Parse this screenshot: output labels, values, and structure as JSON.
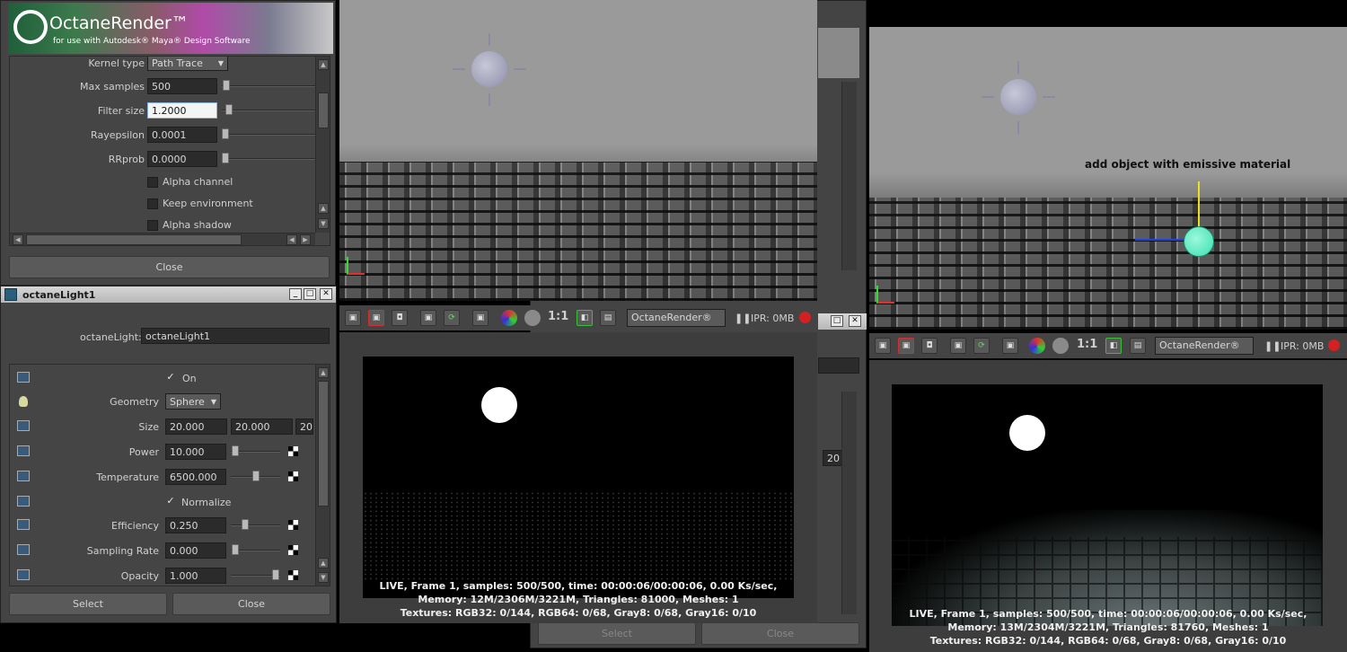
{
  "header": {
    "logo_title": "OctaneRender™",
    "logo_subtitle": "for use with Autodesk® Maya® Design Software"
  },
  "settings": {
    "kernel_label": "Kernel type",
    "kernel_value": "Path Trace",
    "max_samples_label": "Max samples",
    "max_samples_value": "500",
    "filter_size_label": "Filter size",
    "filter_size_value": "1.2000",
    "rayepsilon_label": "Rayepsilon",
    "rayepsilon_value": "0.0001",
    "rrprob_label": "RRprob",
    "rrprob_value": "0.0000",
    "alpha_channel_label": "Alpha channel",
    "keep_env_label": "Keep environment",
    "alpha_shadow_label": "Alpha shadow",
    "close_label": "Close"
  },
  "light_window": {
    "title": "octaneLight1",
    "name_label": "octaneLight:",
    "name_value": "octaneLight1",
    "on_label": "On",
    "on_checked": "✓",
    "geometry_label": "Geometry",
    "geometry_value": "Sphere",
    "size_label": "Size",
    "size_x": "20.000",
    "size_y": "20.000",
    "size_z": "20",
    "power_label": "Power",
    "power_value": "10.000",
    "temperature_label": "Temperature",
    "temperature_value": "6500.000",
    "normalize_label": "Normalize",
    "normalize_checked": "✓",
    "efficiency_label": "Efficiency",
    "efficiency_value": "0.250",
    "sampling_label": "Sampling Rate",
    "sampling_value": "0.000",
    "opacity_label": "Opacity",
    "opacity_value": "1.000",
    "select_label": "Select",
    "close_label": "Close"
  },
  "render_toolbar": {
    "ratio": "1:1",
    "renderer": "OctaneRender®",
    "ipr": "IPR: 0MB"
  },
  "render_left": {
    "line1": "LIVE, Frame 1, samples: 500/500, time: 00:00:06/00:00:06, 0.00 Ks/sec,",
    "line2": "Memory: 12M/2306M/3221M, Triangles: 81000, Meshes: 1",
    "line3": "Textures: RGB32: 0/144, RGB64: 0/68, Gray8: 0/68, Gray16: 0/10"
  },
  "render_right": {
    "line1": "LIVE, Frame 1, samples: 500/500, time: 00:00:06/00:00:06, 0.00 Ks/sec,",
    "line2": "Memory: 13M/2304M/3221M, Triangles: 81760, Meshes: 1",
    "line3": "Textures: RGB32: 0/144, RGB64: 0/68, Gray8: 0/68, Gray16: 0/10"
  },
  "annotation": "add object with emissive material",
  "background_window": {
    "select_label": "Select",
    "close_label": "Close",
    "size_z": "20"
  },
  "colors": {
    "panel": "#444444",
    "record": "#d42020",
    "gizmo": "#39e0b0"
  }
}
